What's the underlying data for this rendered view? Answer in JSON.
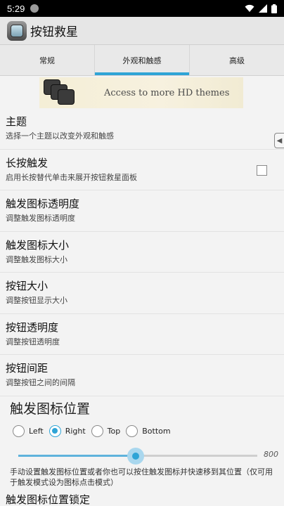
{
  "status_bar": {
    "time": "5:29"
  },
  "app": {
    "title": "按钮救星"
  },
  "tabs": [
    {
      "label": "常规",
      "active": false
    },
    {
      "label": "外观和触感",
      "active": true
    },
    {
      "label": "高级",
      "active": false
    }
  ],
  "banner": {
    "text": "Access to more HD themes"
  },
  "settings": [
    {
      "title": "主题",
      "subtitle": "选择一个主题以改变外观和触感"
    },
    {
      "title": "长按触发",
      "subtitle": "启用长按替代单击来展开按钮救星面板",
      "checked": false
    },
    {
      "title": "触发图标透明度",
      "subtitle": "调整触发图标透明度"
    },
    {
      "title": "触发图标大小",
      "subtitle": "调整触发图标大小"
    },
    {
      "title": "按钮大小",
      "subtitle": "调整按钮显示大小"
    },
    {
      "title": "按钮透明度",
      "subtitle": "调整按钮透明度"
    },
    {
      "title": "按钮间距",
      "subtitle": "调整按钮之间的间隔"
    }
  ],
  "position_section": {
    "title": "触发图标位置",
    "options": [
      "Left",
      "Right",
      "Top",
      "Bottom"
    ],
    "selected": "Right",
    "slider_value": "800",
    "slider_fraction": 0.49,
    "description": "手动设置触发图标位置或者你也可以按住触发图标并快速移到其位置（仅可用于触发模式设为图标点击模式）",
    "next_title_partial": "触发图标位置锁定"
  },
  "colors": {
    "accent": "#2fa4d6"
  }
}
